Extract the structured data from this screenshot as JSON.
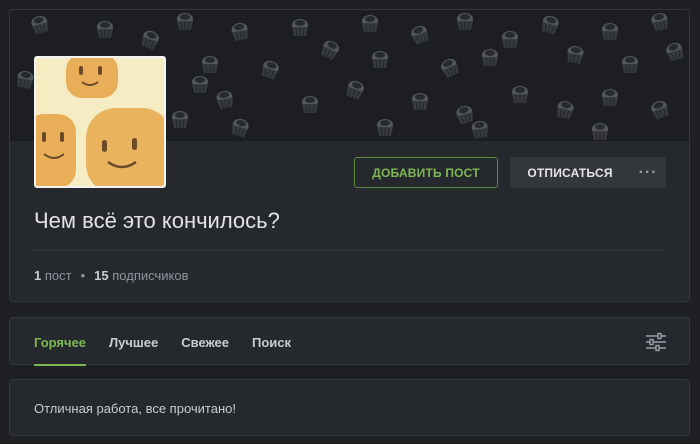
{
  "community": {
    "title": "Чем всё это кончилось?",
    "add_post_label": "ДОБАВИТЬ ПОСТ",
    "unsubscribe_label": "ОТПИСАТЬСЯ",
    "more_label": "···",
    "stats": {
      "posts_count": "1",
      "posts_word": "пост",
      "separator": "•",
      "subscribers_count": "15",
      "subscribers_word": "подписчиков"
    }
  },
  "tabs": [
    {
      "label": "Горячее",
      "active": true
    },
    {
      "label": "Лучшее",
      "active": false
    },
    {
      "label": "Свежее",
      "active": false
    },
    {
      "label": "Поиск",
      "active": false
    }
  ],
  "feed": {
    "message": "Отличная работа, все прочитано!"
  },
  "colors": {
    "accent": "#7eb854",
    "background": "#1e2023",
    "card": "#25282c"
  },
  "icons": {
    "banner_pattern": "cupcake-pattern",
    "filter": "filter-sliders-icon"
  }
}
